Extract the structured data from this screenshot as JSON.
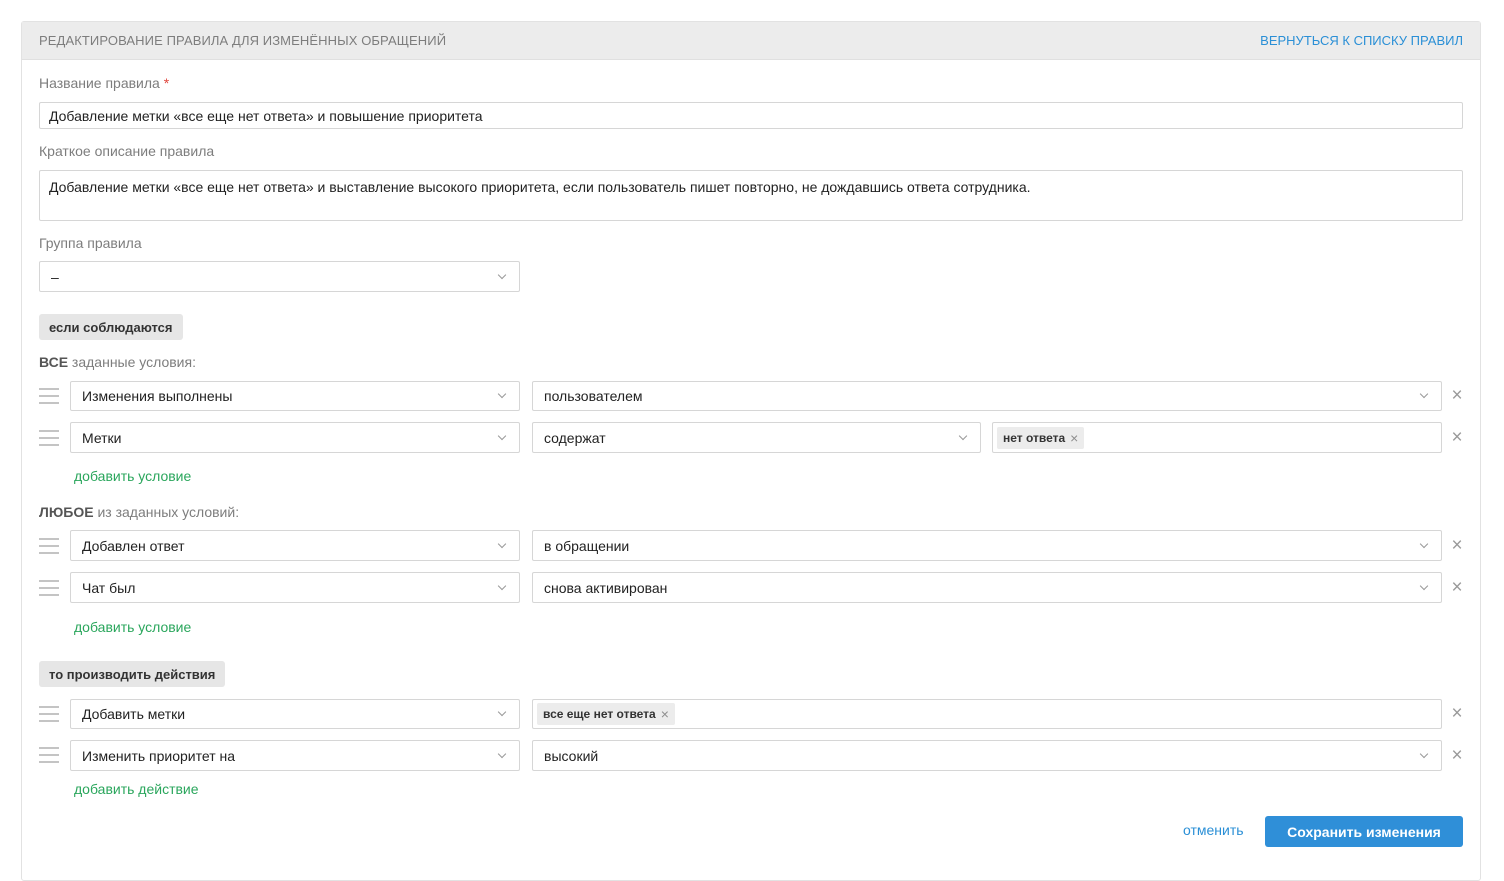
{
  "header": {
    "title": "РЕДАКТИРОВАНИЕ ПРАВИЛА ДЛЯ ИЗМЕНЁННЫХ ОБРАЩЕНИЙ",
    "back_link": "ВЕРНУТЬСЯ К СПИСКУ ПРАВИЛ"
  },
  "form": {
    "name_label": "Название правила",
    "required_mark": "*",
    "name_value": "Добавление метки «все еще нет ответа» и повышение приоритета",
    "description_label": "Краткое описание правила",
    "description_value": "Добавление метки «все еще нет ответа» и выставление высокого приоритета, если пользователь пишет повторно, не дождавшись ответа сотрудника.",
    "group_label": "Группа правила",
    "group_value": "–"
  },
  "conditions": {
    "section_label": "если соблюдаются",
    "all_title_bold": "ВСЕ",
    "all_title_rest": " заданные условия:",
    "all": [
      {
        "field": "Изменения выполнены",
        "operator": "пользователем"
      },
      {
        "field": "Метки",
        "operator": "содержат",
        "tag": "нет ответа"
      }
    ],
    "any_title_bold": "ЛЮБОЕ",
    "any_title_rest": " из заданных условий:",
    "any": [
      {
        "field": "Добавлен ответ",
        "operator": "в обращении"
      },
      {
        "field": "Чат был",
        "operator": "снова активирован"
      }
    ],
    "add_condition": "добавить условие"
  },
  "actions": {
    "section_label": "то производить действия",
    "items": [
      {
        "field": "Добавить метки",
        "tag": "все еще нет ответа"
      },
      {
        "field": "Изменить приоритет на",
        "value": "высокий"
      }
    ],
    "add_action": "добавить действие"
  },
  "footer": {
    "cancel": "отменить",
    "save": "Сохранить изменения"
  },
  "icons": {
    "remove": "×",
    "tag_remove": "×"
  },
  "colors": {
    "accent_blue": "#2a8fd6",
    "add_green": "#2aa65c",
    "required_red": "#e0463d",
    "button_blue": "#2f8fd8"
  }
}
